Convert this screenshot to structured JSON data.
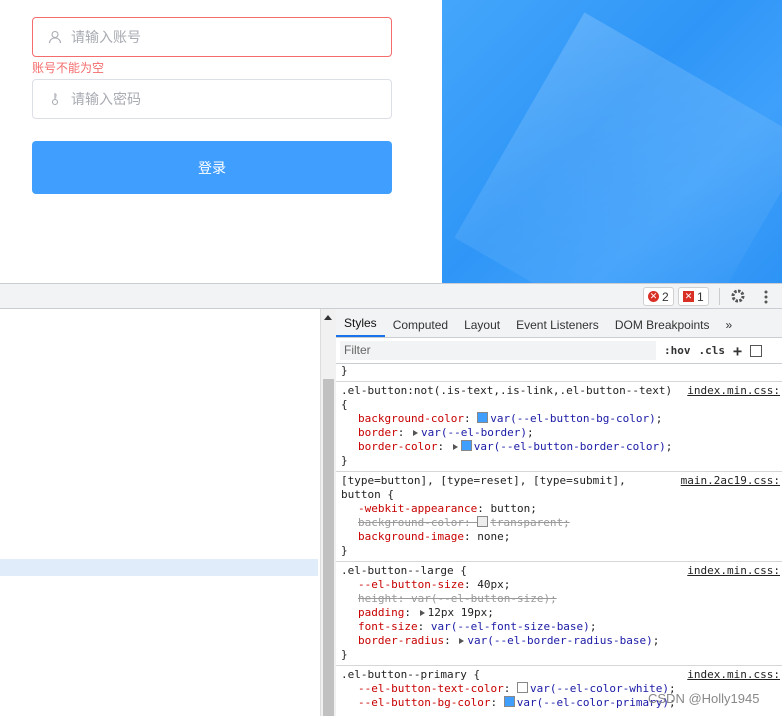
{
  "login": {
    "account_placeholder": "请输入账号",
    "account_error": "账号不能为空",
    "password_placeholder": "请输入密码",
    "submit_label": "登录"
  },
  "devtools": {
    "error_count": "2",
    "issue_count": "1",
    "tabs": [
      "Styles",
      "Computed",
      "Layout",
      "Event Listeners",
      "DOM Breakpoints"
    ],
    "more_tabs": "»",
    "filter_placeholder": "Filter",
    "hov": ":hov",
    "cls": ".cls",
    "add": "+",
    "rules": [
      {
        "selector": ".el-button:not(.is-text,.is-link,.el-button--text)",
        "source": "index.min.css:",
        "open": "{",
        "props": [
          {
            "name": "background-color",
            "value": "var(--el-button-bg-color)",
            "swatch": "#409eff"
          },
          {
            "name": "border",
            "value": "var(--el-border)",
            "tri": true
          },
          {
            "name": "border-color",
            "value": "var(--el-button-border-color)",
            "tri": true,
            "swatch": "#409eff"
          }
        ]
      },
      {
        "selector": "[type=button], [type=reset], [type=submit],",
        "selector2": "button {",
        "source": "main.2ac19.css:",
        "props": [
          {
            "name": "-webkit-appearance",
            "value": "button"
          },
          {
            "name": "background-color",
            "value": "transparent",
            "struck": true,
            "swatch": "transparent"
          },
          {
            "name": "background-image",
            "value": "none"
          }
        ]
      },
      {
        "selector": ".el-button--large {",
        "source": "index.min.css:",
        "props": [
          {
            "name": "--el-button-size",
            "value": "40px"
          },
          {
            "name": "height",
            "value": "var(--el-button-size)",
            "struck": true
          },
          {
            "name": "padding",
            "value": "12px 19px",
            "tri": true
          },
          {
            "name": "font-size",
            "value": "var(--el-font-size-base)"
          },
          {
            "name": "border-radius",
            "value": "var(--el-border-radius-base)",
            "tri": true
          }
        ]
      },
      {
        "selector": ".el-button--primary {",
        "source": "index.min.css:",
        "props": [
          {
            "name": "--el-button-text-color",
            "value": "var(--el-color-white)",
            "swatch": "#ffffff"
          },
          {
            "name": "--el-button-bg-color",
            "value": "var(--el-color-primary)",
            "swatch": "#409eff"
          }
        ]
      }
    ],
    "close_brace": "}"
  },
  "watermark": "CSDN @Holly1945"
}
